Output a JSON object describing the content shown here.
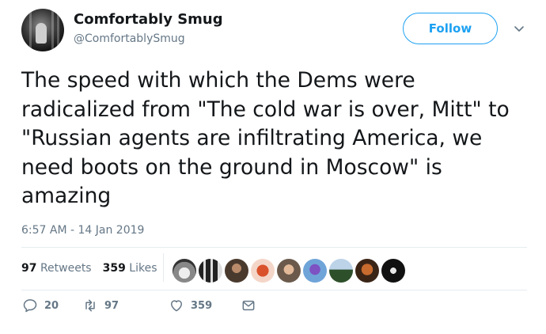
{
  "author": {
    "name": "Comfortably Smug",
    "handle": "@ComfortablySmug"
  },
  "follow_label": "Follow",
  "tweet_text": "The speed with which the Dems were radicalized from \"The cold war is over, Mitt\" to \"Russian agents are infiltrating America, we need boots on the ground in Moscow\" is amazing",
  "timestamp": "6:57 AM - 14 Jan 2019",
  "stats": {
    "retweets_count": "97",
    "retweets_label": "Retweets",
    "likes_count": "359",
    "likes_label": "Likes"
  },
  "actions": {
    "reply_count": "20",
    "retweet_count": "97",
    "like_count": "359"
  },
  "icons": {
    "caret": "chevron-down-icon",
    "reply": "reply-icon",
    "retweet": "retweet-icon",
    "like": "heart-icon",
    "dm": "envelope-icon"
  },
  "colors": {
    "accent": "#1da1f2",
    "text": "#14171a",
    "muted": "#657786"
  }
}
